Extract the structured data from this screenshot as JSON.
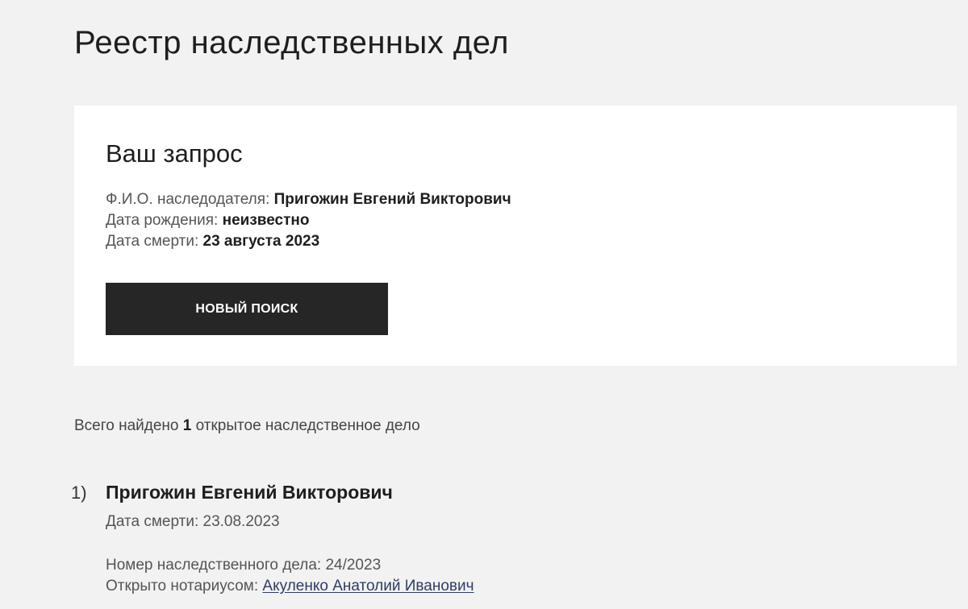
{
  "page": {
    "title": "Реестр наследственных дел"
  },
  "request": {
    "heading": "Ваш запрос",
    "fio_label": "Ф.И.О. наследодателя:",
    "fio_value": "Пригожин Евгений Викторович",
    "birth_label": "Дата рождения:",
    "birth_value": "неизвестно",
    "death_label": "Дата смерти:",
    "death_value": "23 августа 2023",
    "new_search_label": "НОВЫЙ ПОИСК"
  },
  "summary": {
    "prefix": "Всего найдено",
    "count": "1",
    "suffix": "открытое наследственное дело"
  },
  "results": [
    {
      "number": "1)",
      "name": "Пригожин Евгений Викторович",
      "death_label": "Дата смерти:",
      "death_value": "23.08.2023",
      "case_label": "Номер наследственного дела:",
      "case_value": "24/2023",
      "notary_label": "Открыто нотариусом:",
      "notary_value": "Акуленко Анатолий Иванович"
    }
  ]
}
